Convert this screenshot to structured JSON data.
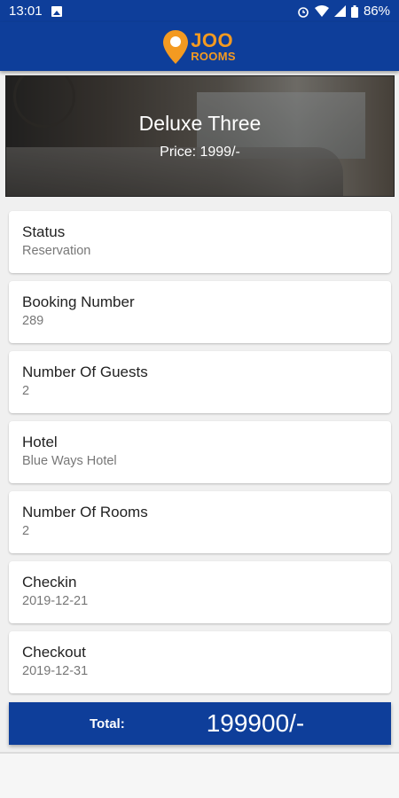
{
  "status_bar": {
    "time": "13:01",
    "battery": "86%",
    "icons": [
      "image-notification-icon",
      "alarm-icon",
      "wifi-icon",
      "signal-icon",
      "battery-icon"
    ]
  },
  "app_bar": {
    "logo_line1": "JOO",
    "logo_line2": "ROOMS",
    "logo_icon": "location-pin-icon",
    "brand_color": "#0e3e9a",
    "accent_color": "#f39a21"
  },
  "room": {
    "title": "Deluxe Three",
    "price": "Price: 1999/-"
  },
  "details": [
    {
      "label": "Status",
      "value": "Reservation"
    },
    {
      "label": "Booking Number",
      "value": "289"
    },
    {
      "label": "Number Of Guests",
      "value": "2"
    },
    {
      "label": "Hotel",
      "value": "Blue Ways Hotel"
    },
    {
      "label": "Number Of Rooms",
      "value": "2"
    },
    {
      "label": "Checkin",
      "value": "2019-12-21"
    },
    {
      "label": "Checkout",
      "value": "2019-12-31"
    }
  ],
  "total": {
    "label": "Total:",
    "value": "199900/-"
  }
}
